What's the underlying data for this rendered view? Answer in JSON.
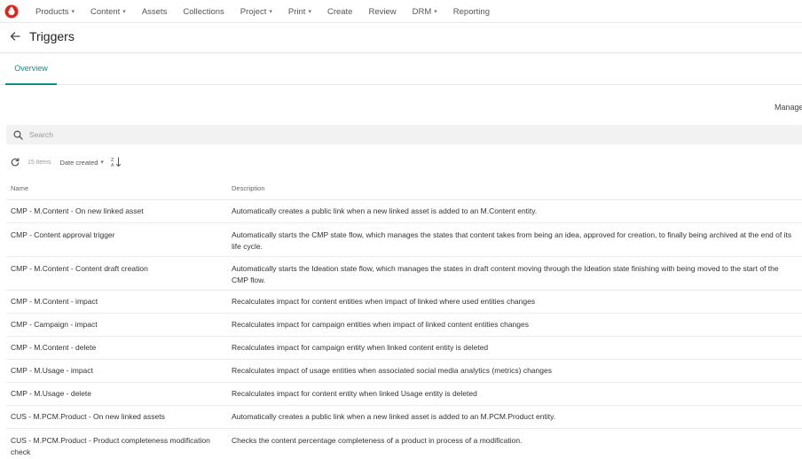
{
  "nav": {
    "items": [
      {
        "label": "Products",
        "caret": "▾"
      },
      {
        "label": "Content",
        "caret": "▾"
      },
      {
        "label": "Assets",
        "caret": ""
      },
      {
        "label": "Collections",
        "caret": ""
      },
      {
        "label": "Project",
        "caret": "▾"
      },
      {
        "label": "Print",
        "caret": "▾"
      },
      {
        "label": "Create",
        "caret": ""
      },
      {
        "label": "Review",
        "caret": ""
      },
      {
        "label": "DRM",
        "caret": "▾"
      },
      {
        "label": "Reporting",
        "caret": ""
      }
    ]
  },
  "header": {
    "title": "Triggers"
  },
  "tabs": {
    "overview": "Overview"
  },
  "actions": {
    "manage": "Manage"
  },
  "search": {
    "placeholder": "Search"
  },
  "toolbar": {
    "count": "15 items",
    "sort_label": "Date created",
    "sort_caret": "▾"
  },
  "table": {
    "columns": {
      "name": "Name",
      "description": "Description"
    },
    "rows": [
      {
        "name": "CMP - M.Content - On new linked asset",
        "description": "Automatically creates a public link when a new linked asset is added to an M.Content entity."
      },
      {
        "name": "CMP - Content approval trigger",
        "description": "Automatically starts the CMP state flow, which manages the states that content takes from being an idea, approved for creation, to finally being archived at the end of its life cycle."
      },
      {
        "name": "CMP - M.Content - Content draft creation",
        "description": "Automatically starts the Ideation state flow, which manages the states in draft content moving through the Ideation state finishing with being moved to the start of the CMP flow."
      },
      {
        "name": "CMP - M.Content - impact",
        "description": "Recalculates impact for content entities when impact of linked where used entities changes"
      },
      {
        "name": "CMP - Campaign - impact",
        "description": "Recalculates impact for campaign entities when impact of linked content entities changes"
      },
      {
        "name": "CMP - M.Content - delete",
        "description": "Recalculates impact for campaign entity when linked content entity is deleted"
      },
      {
        "name": "CMP - M.Usage - impact",
        "description": "Recalculates impact of usage entities when associated social media analytics (metrics) changes"
      },
      {
        "name": "CMP - M.Usage - delete",
        "description": "Recalculates impact for content entity when linked Usage entity is deleted"
      },
      {
        "name": "CUS - M.PCM.Product - On new linked assets",
        "description": "Automatically creates a public link when a new linked asset is added to an M.PCM.Product entity."
      },
      {
        "name": "CUS - M.PCM.Product - Product completeness modification check",
        "description": "Checks the content percentage completeness of a product in process of a modification."
      }
    ]
  },
  "colors": {
    "accent": "#0d8f86",
    "logo": "#e2231a"
  }
}
